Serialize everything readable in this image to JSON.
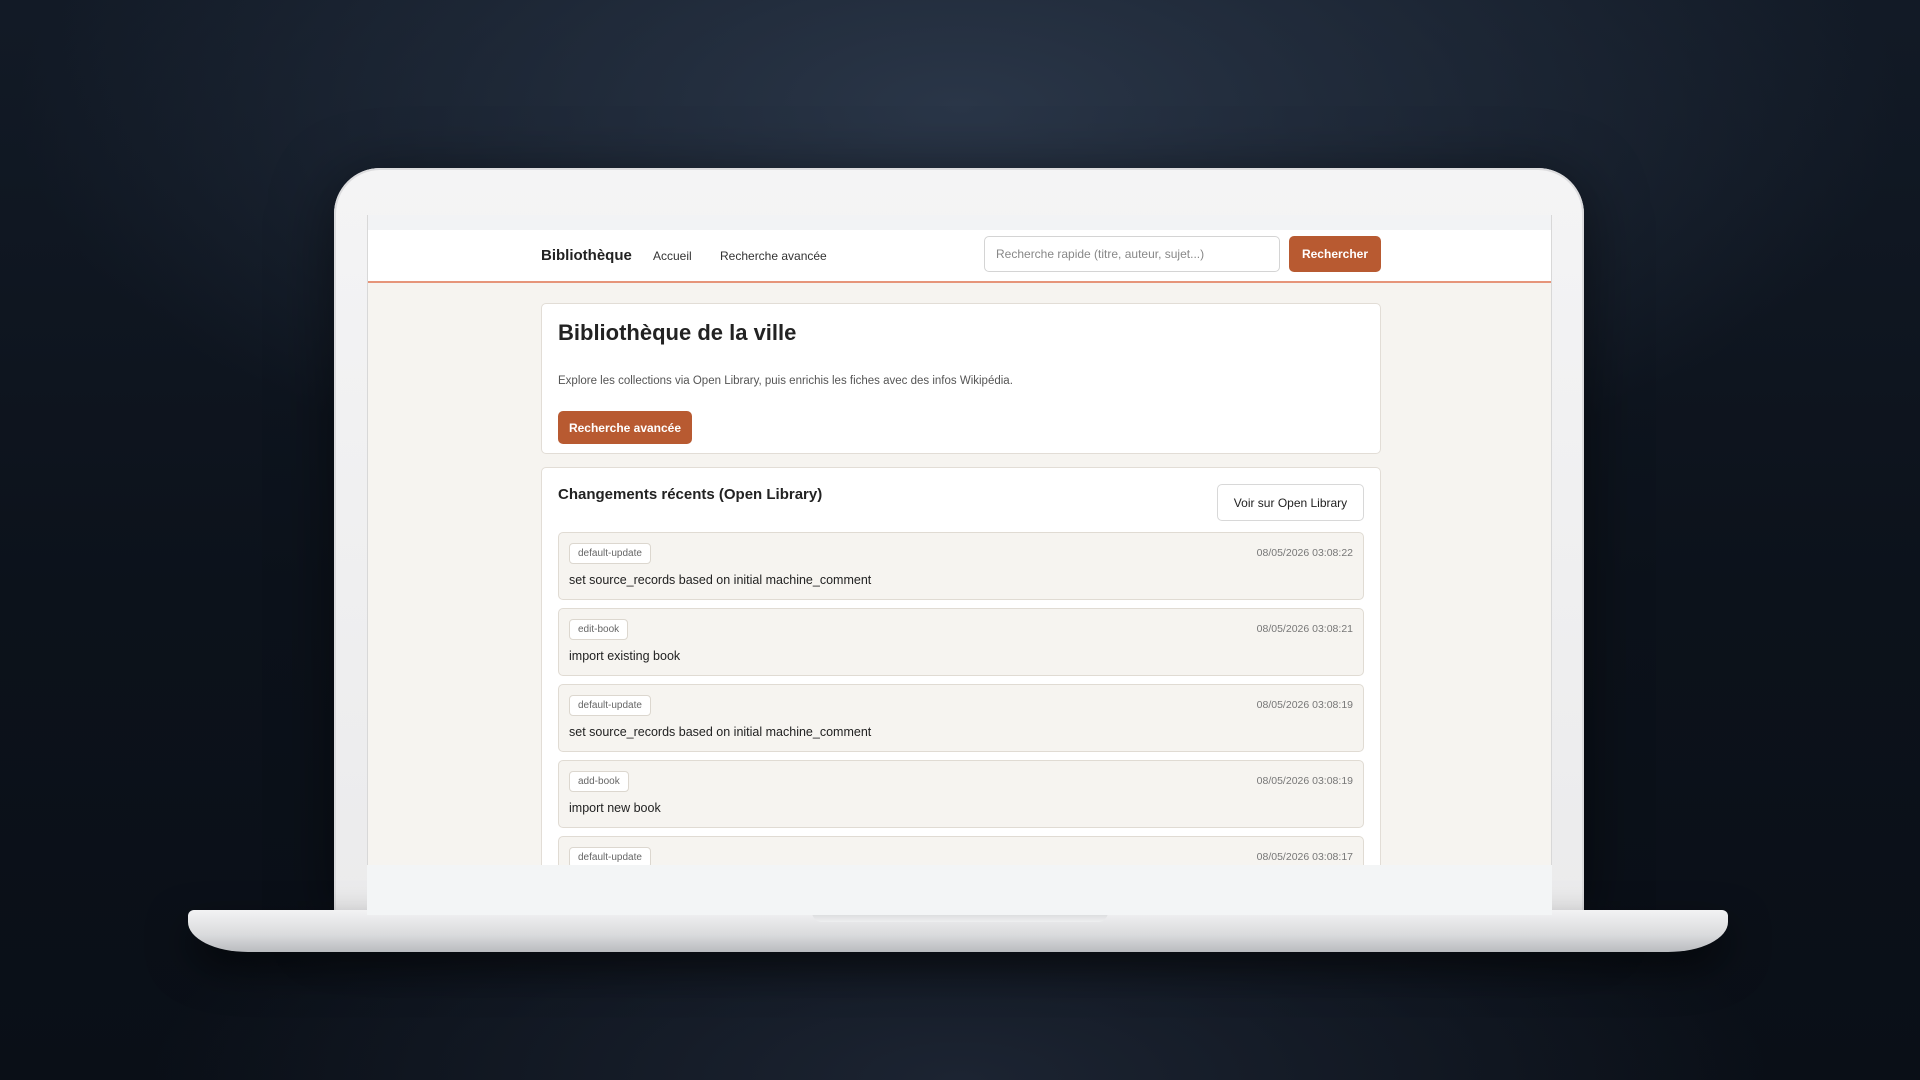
{
  "navbar": {
    "brand": "Bibliothèque",
    "links": [
      "Accueil",
      "Recherche avancée"
    ],
    "search_placeholder": "Recherche rapide (titre, auteur, sujet...)",
    "search_button": "Rechercher"
  },
  "hero": {
    "title": "Bibliothèque de la ville",
    "description": "Explore les collections via Open Library, puis enrichis les fiches avec des infos Wikipédia.",
    "button": "Recherche avancée"
  },
  "recent_changes": {
    "title": "Changements récents (Open Library)",
    "view_button": "Voir sur Open Library",
    "items": [
      {
        "tag": "default-update",
        "timestamp": "08/05/2026 03:08:22",
        "comment": "set source_records based on initial machine_comment"
      },
      {
        "tag": "edit-book",
        "timestamp": "08/05/2026 03:08:21",
        "comment": "import existing book"
      },
      {
        "tag": "default-update",
        "timestamp": "08/05/2026 03:08:19",
        "comment": "set source_records based on initial machine_comment"
      },
      {
        "tag": "add-book",
        "timestamp": "08/05/2026 03:08:19",
        "comment": "import new book"
      },
      {
        "tag": "default-update",
        "timestamp": "08/05/2026 03:08:17",
        "comment": ""
      }
    ]
  },
  "colors": {
    "accent": "#b85a31",
    "nav_border": "#e6957a",
    "page_background": "#f6f4f0"
  }
}
